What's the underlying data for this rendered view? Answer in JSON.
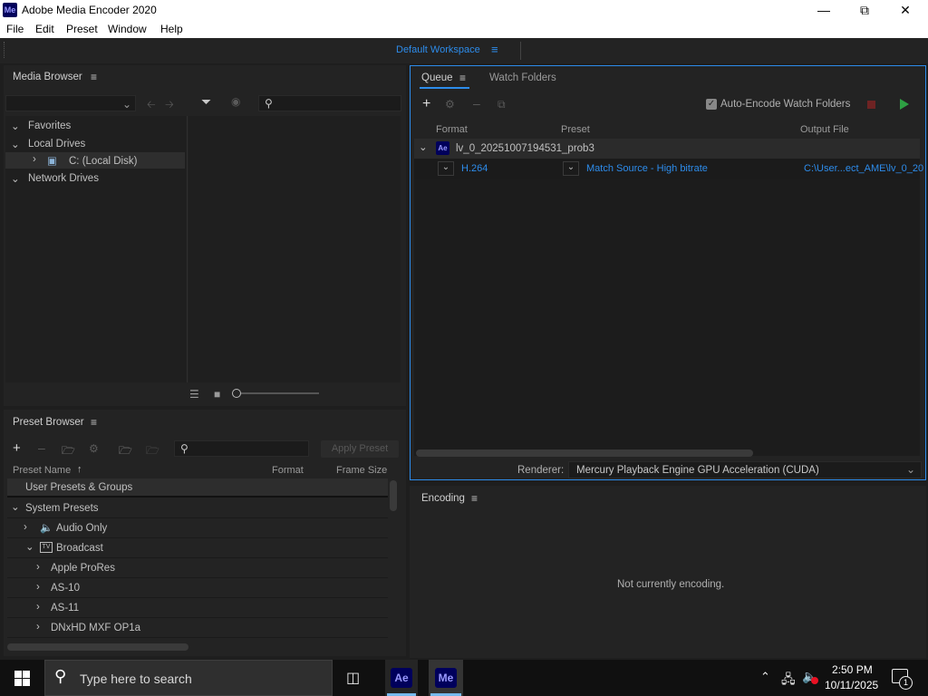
{
  "app": {
    "title": "Adobe Media Encoder 2020",
    "logo": "Me"
  },
  "menu": [
    "File",
    "Edit",
    "Preset",
    "Window",
    "Help"
  ],
  "workspace": {
    "label": "Default Workspace"
  },
  "media_browser": {
    "title": "Media Browser",
    "tree": {
      "favorites": "Favorites",
      "local_drives": "Local Drives",
      "local_disk": "C: (Local Disk)",
      "network_drives": "Network Drives"
    }
  },
  "preset_browser": {
    "title": "Preset Browser",
    "apply_label": "Apply Preset",
    "columns": {
      "name": "Preset Name",
      "format": "Format",
      "frame_size": "Frame Size"
    },
    "rows": {
      "user": "User Presets & Groups",
      "system": "System Presets",
      "audio_only": "Audio Only",
      "broadcast": "Broadcast",
      "apple_prores": "Apple ProRes",
      "as10": "AS-10",
      "as11": "AS-11",
      "dnxhd": "DNxHD MXF OP1a"
    }
  },
  "queue": {
    "tab_queue": "Queue",
    "tab_watch": "Watch Folders",
    "auto_encode": "Auto-Encode Watch Folders",
    "columns": {
      "format": "Format",
      "preset": "Preset",
      "output": "Output File"
    },
    "item": {
      "badge": "Ae",
      "name": "lv_0_20251007194531_prob3",
      "format": "H.264",
      "preset": "Match Source - High bitrate",
      "output": "C:\\User...ect_AME\\lv_0_20"
    },
    "renderer_label": "Renderer:",
    "renderer_value": "Mercury Playback Engine GPU Acceleration (CUDA)"
  },
  "encoding": {
    "title": "Encoding",
    "status": "Not currently encoding."
  },
  "taskbar": {
    "search_placeholder": "Type here to search",
    "ae": "Ae",
    "me": "Me",
    "time": "2:50 PM",
    "date": "10/11/2025",
    "notif_count": "1"
  }
}
